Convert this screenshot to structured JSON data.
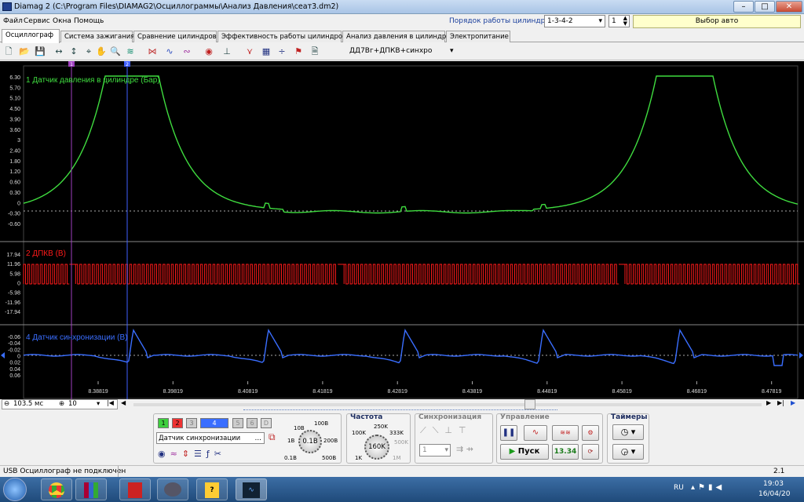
{
  "window": {
    "title": "Diamag 2 (C:\\Program Files\\DIAMAG2\\Осциллограммы\\Анализ Давления\\сеат3.dm2)"
  },
  "menu": [
    "Файл",
    "Сервис",
    "Окна",
    "Помощь"
  ],
  "cylinder": {
    "label": "Порядок работы цилиндров",
    "order": "1-3-4-2",
    "number": "1",
    "auto_button": "Выбор авто"
  },
  "tabs": [
    "Осциллограф",
    "Система зажигания",
    "Сравнение цилиндров",
    "Эффективность работы цилиндров",
    "Анализ давления в цилиндре",
    "Электропитание"
  ],
  "toolbar": {
    "preset": "ДД7Вг+ДПКВ+синхро"
  },
  "scope": {
    "ch1": {
      "label": "1 Датчик давления в цилиндре (Бар)",
      "color": "#3fdc3f",
      "ticks": [
        "6.30",
        "5.70",
        "5.10",
        "4.50",
        "3.90",
        "3.60",
        "3",
        "2.40",
        "1.80",
        "1.20",
        "0.60",
        "0.30",
        "0",
        "-0.30",
        "-0.60"
      ]
    },
    "ch2": {
      "label": "2 ДПКВ (В)",
      "color": "#ff1a1a",
      "ticks": [
        "17.94",
        "11.96",
        "5.98",
        "0",
        "-5.98",
        "-11.96",
        "-17.94"
      ]
    },
    "ch4": {
      "label": "4 Датчик синхронизации (В)",
      "color": "#3a6eff",
      "ticks": [
        "-0.06",
        "-0.04",
        "-0.02",
        "0",
        "0.02",
        "0.04",
        "0.06"
      ]
    },
    "time_ticks": [
      "8.38819",
      "8.39819",
      "8.40819",
      "8.41819",
      "8.42819",
      "8.43819",
      "8.44819",
      "8.45819",
      "8.46819",
      "8.47819"
    ],
    "cursor1": "1",
    "cursor2": "2"
  },
  "nav": {
    "timebase": "103.5 мс",
    "count": "10"
  },
  "channels": {
    "buttons": [
      "1",
      "2",
      "3",
      "4",
      "5",
      "6",
      "D"
    ],
    "sensor": "Датчик синхронизации",
    "range_center": "0.1В",
    "range_labels": [
      "10В",
      "100В",
      "1В",
      "200В",
      "0.1В",
      "500В"
    ]
  },
  "freq": {
    "title": "Частота",
    "center": "160K",
    "labels": [
      "250K",
      "100K",
      "333K",
      "500K",
      "1K",
      "1M"
    ]
  },
  "sync": {
    "title": "Синхронизация",
    "value": "1"
  },
  "control": {
    "title": "Управление",
    "start": "Пуск",
    "value": "13.34"
  },
  "timers": {
    "title": "Таймеры"
  },
  "status": {
    "left": "USB Осциллограф не подключен",
    "right": "2.1"
  },
  "taskbar": {
    "lang": "RU",
    "time": "19:03",
    "date": "16/04/20"
  }
}
